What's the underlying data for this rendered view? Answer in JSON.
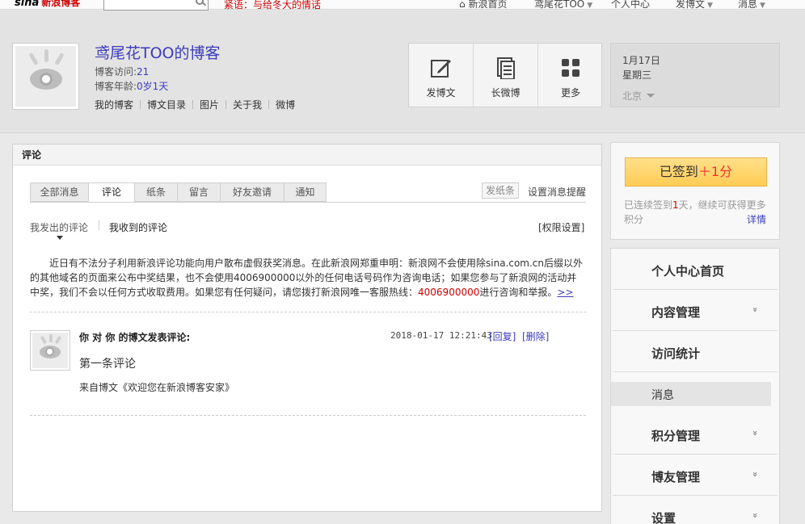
{
  "topbar": {
    "logo": "sina",
    "logo_sub": "新浪博客",
    "notice": "紧语：与给冬大的情话",
    "nav": {
      "home": "新浪首页",
      "user": "鸢尾花TOO",
      "center": "个人中心",
      "post": "发博文",
      "msg": "消息"
    }
  },
  "header": {
    "blog_name": "鸢尾花TOO的博客",
    "visits_label": "博客访问:",
    "visits_value": "21",
    "age_label": "博客年龄:",
    "age_value": "0岁1天",
    "links": [
      "我的博客",
      "博文目录",
      "图片",
      "关于我",
      "微博"
    ],
    "tools": {
      "post": "发博文",
      "long": "长微博",
      "more": "更多"
    },
    "date": "1月17日",
    "weekday": "星期三",
    "city": "北京"
  },
  "main": {
    "title": "评论",
    "tabs": [
      "全部消息",
      "评论",
      "纸条",
      "留言",
      "好友邀请",
      "通知"
    ],
    "note_btn": "发纸条",
    "remind": "设置消息提醒",
    "sub_sent": "我发出的评论",
    "sub_recv": "我收到的评论",
    "permission": "[权限设置]",
    "announce_pre": "近日有不法分子利用新浪评论功能向用户散布虚假获奖消息。在此新浪网郑重申明：新浪网不会使用除sina.com.cn后缀以外的其他域名的页面来公布中奖结果，也不会使用4006900000以外的任何电话号码作为咨询电话；如果您参与了新浪网的活动并中奖，我们不会以任何方式收取费用。如果您有任何疑问，请您拨打新浪网唯一客服热线：",
    "announce_phone": "4006900000",
    "announce_post": "进行咨询和举报。",
    "announce_more": ">>",
    "comment": {
      "title": "你 对 你 的博文发表评论:",
      "time": "2018-01-17 12:21:43",
      "reply": "[回复]",
      "delete": "[删除]",
      "body": "第一条评论",
      "source": "来自博文《欢迎您在新浪博客安家》"
    }
  },
  "sign": {
    "button_text": "已签到",
    "button_plus": "＋1分",
    "info_pre": "已连续签到",
    "info_num": "1",
    "info_post": "天，继续可获得更多积分",
    "detail": "详情"
  },
  "menu": {
    "items": [
      "个人中心首页",
      "内容管理",
      "访问统计",
      "消息",
      "积分管理",
      "博友管理",
      "设置"
    ],
    "chevron": "»"
  }
}
